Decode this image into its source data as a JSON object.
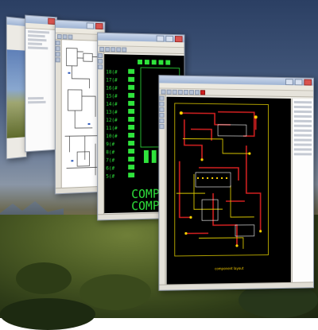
{
  "desktop": {
    "wallpaper": "coastal shrub landscape under blue cloudy sky"
  },
  "windows": [
    {
      "id": "window-1",
      "content": "photo viewer"
    },
    {
      "id": "window-2",
      "content": "file tree panel"
    },
    {
      "id": "window-3",
      "content": "schematic editor"
    },
    {
      "id": "window-4",
      "content": "footprint editor",
      "footprint_label_line1": "COMP",
      "footprint_label_line2": "COMP"
    },
    {
      "id": "window-5",
      "content": "pcb layout editor",
      "board_label": "component layout"
    }
  ],
  "colors": {
    "pcb_background": "#000000",
    "copper_top": "#d32020",
    "copper_bottom": "#d6c400",
    "silkscreen": "#ffffff",
    "pad_green": "#2fe43c",
    "pad_yellow": "#ffd400"
  }
}
